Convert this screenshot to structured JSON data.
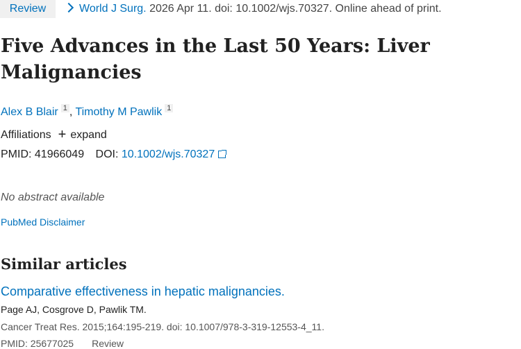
{
  "header": {
    "badge": "Review",
    "journal": "World J Surg.",
    "citation_rest": "2026 Apr 11. doi: 10.1002/wjs.70327. Online ahead of print."
  },
  "article": {
    "title": "Five Advances in the Last 50 Years: Liver Malignancies",
    "authors": [
      {
        "name": "Alex B Blair",
        "aff": "1"
      },
      {
        "name": "Timothy M Pawlik",
        "aff": "1"
      }
    ],
    "affiliations_label": "Affiliations",
    "expand_label": "expand",
    "pmid_label": "PMID:",
    "pmid": "41966049",
    "doi_label": "DOI:",
    "doi": "10.1002/wjs.70327",
    "no_abstract": "No abstract available",
    "disclaimer": "PubMed Disclaimer"
  },
  "similar": {
    "heading": "Similar articles",
    "items": [
      {
        "title": "Comparative effectiveness in hepatic malignancies.",
        "authors": "Page AJ, Cosgrove D, Pawlik TM.",
        "citation": "Cancer Treat Res. 2015;164:195-219. doi: 10.1007/978-3-319-12553-4_11.",
        "pmid_label": "PMID:",
        "pmid": "25677025",
        "type": "Review"
      }
    ]
  },
  "colors": {
    "link": "#0071bc",
    "text": "#212121",
    "badge_bg": "#f0f0f0"
  }
}
